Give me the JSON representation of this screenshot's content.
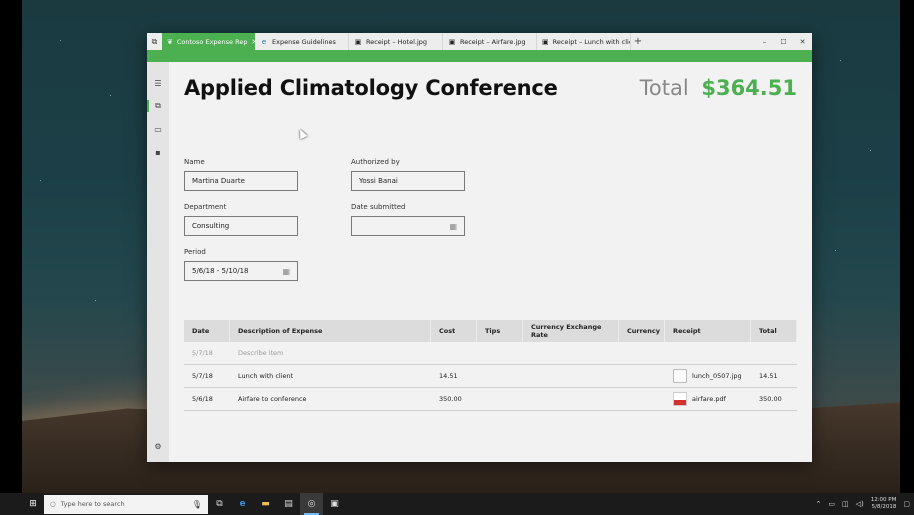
{
  "window": {
    "tabs": [
      {
        "label": "Contoso Expense Rep",
        "icon": "leaf-icon",
        "active": true
      },
      {
        "label": "Expense Guidelines",
        "icon": "edge-icon",
        "active": false
      },
      {
        "label": "Receipt – Hotel.jpg",
        "icon": "image-icon",
        "active": false
      },
      {
        "label": "Receipt – Airfare.jpg",
        "icon": "image-icon",
        "active": false
      },
      {
        "label": "Receipt – Lunch with clie",
        "icon": "image-icon",
        "active": false
      }
    ],
    "add_tab": "+",
    "controls": {
      "minimize": "–",
      "maximize": "☐",
      "close": "✕"
    }
  },
  "report": {
    "title": "Applied Climatology Conference",
    "total_label": "Total",
    "total_value": "$364.51"
  },
  "form": {
    "name": {
      "label": "Name",
      "value": "Martina Duarte"
    },
    "authorized_by": {
      "label": "Authorized by",
      "value": "Yossi Banai"
    },
    "department": {
      "label": "Department",
      "value": "Consulting"
    },
    "date_submitted": {
      "label": "Date submitted",
      "value": ""
    },
    "period": {
      "label": "Period",
      "value": "5/6/18 - 5/10/18"
    }
  },
  "table": {
    "headers": [
      "Date",
      "Description of Expense",
      "Cost",
      "Tips",
      "Currency Exchange Rate",
      "Currency",
      "Receipt",
      "Total"
    ],
    "placeholder_row": {
      "date": "5/7/18",
      "description": "Describe item"
    },
    "rows": [
      {
        "date": "5/7/18",
        "description": "Lunch with client",
        "cost": "14.51",
        "tips": "",
        "rate": "",
        "currency": "",
        "receipt": "lunch_0507.jpg",
        "receipt_type": "image",
        "total": "14.51"
      },
      {
        "date": "5/6/18",
        "description": "Airfare to conference",
        "cost": "350.00",
        "tips": "",
        "rate": "",
        "currency": "",
        "receipt": "airfare.pdf",
        "receipt_type": "pdf",
        "total": "350.00"
      }
    ]
  },
  "taskbar": {
    "search_placeholder": "Type here to search",
    "time": "12:00 PM",
    "date": "5/8/2018"
  },
  "colors": {
    "accent": "#4caf50"
  }
}
